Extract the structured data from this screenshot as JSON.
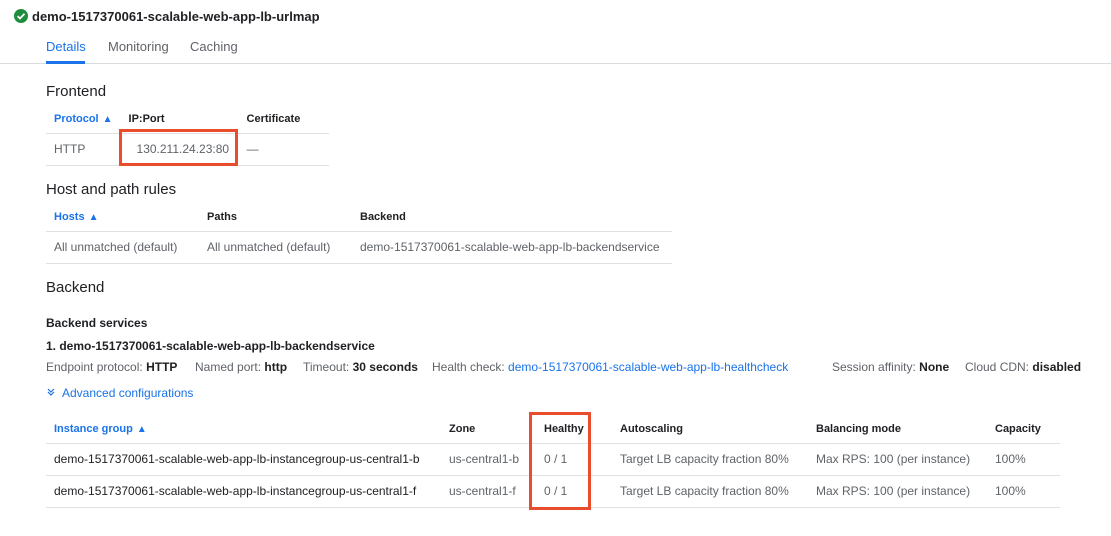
{
  "header": {
    "title": "demo-1517370061-scalable-web-app-lb-urlmap",
    "status_icon": "check-circle-icon",
    "status_color": "#1e8e3e"
  },
  "tabs": [
    {
      "label": "Details",
      "active": true
    },
    {
      "label": "Monitoring",
      "active": false
    },
    {
      "label": "Caching",
      "active": false
    }
  ],
  "frontend": {
    "heading": "Frontend",
    "columns": [
      "Protocol",
      "IP:Port",
      "Certificate"
    ],
    "rows": [
      {
        "protocol": "HTTP",
        "ip_port": "130.211.24.23:80",
        "certificate": "—"
      }
    ]
  },
  "host_rules": {
    "heading": "Host and path rules",
    "columns": [
      "Hosts",
      "Paths",
      "Backend"
    ],
    "rows": [
      {
        "hosts": "All unmatched (default)",
        "paths": "All unmatched (default)",
        "backend": "demo-1517370061-scalable-web-app-lb-backendservice"
      }
    ]
  },
  "backend": {
    "heading": "Backend",
    "services_heading": "Backend services",
    "service_name": "1. demo-1517370061-scalable-web-app-lb-backendservice",
    "endpoint_protocol_label": "Endpoint protocol:",
    "endpoint_protocol_value": "HTTP",
    "named_port_label": "Named port:",
    "named_port_value": "http",
    "timeout_label": "Timeout:",
    "timeout_value": "30 seconds",
    "health_check_label": "Health check:",
    "health_check_value": "demo-1517370061-scalable-web-app-lb-healthcheck",
    "session_affinity_label": "Session affinity:",
    "session_affinity_value": "None",
    "cdn_label": "Cloud CDN:",
    "cdn_value": "disabled",
    "advanced_label": "Advanced configurations",
    "columns": [
      "Instance group",
      "Zone",
      "Healthy",
      "Autoscaling",
      "Balancing mode",
      "Capacity"
    ],
    "rows": [
      {
        "group": "demo-1517370061-scalable-web-app-lb-instancegroup-us-central1-b",
        "zone": "us-central1-b",
        "healthy": "0 / 1",
        "autoscaling": "Target LB capacity fraction 80%",
        "mode": "Max RPS: 100 (per instance)",
        "capacity": "100%"
      },
      {
        "group": "demo-1517370061-scalable-web-app-lb-instancegroup-us-central1-f",
        "zone": "us-central1-f",
        "healthy": "0 / 1",
        "autoscaling": "Target LB capacity fraction 80%",
        "mode": "Max RPS: 100 (per instance)",
        "capacity": "100%"
      }
    ]
  },
  "highlight_color": "#ea4d2c",
  "accent_color": "#1a73e8"
}
